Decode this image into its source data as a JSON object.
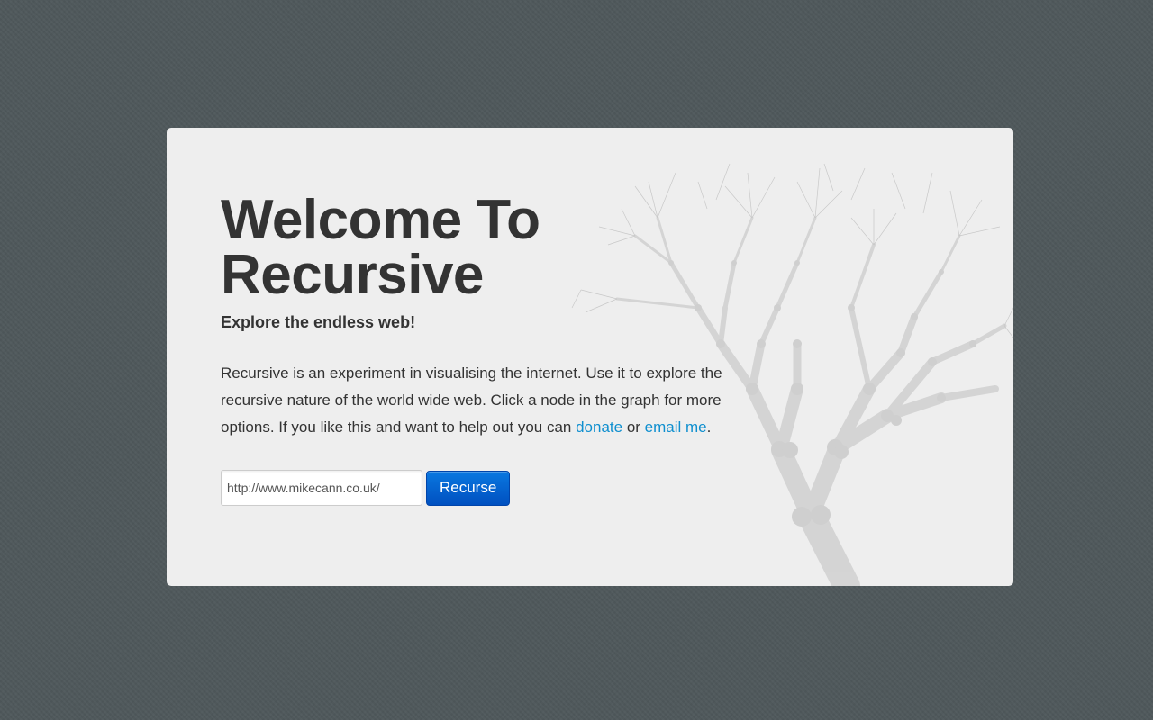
{
  "hero": {
    "title_line1": "Welcome To",
    "title_line2": "Recursive",
    "subtitle": "Explore the endless web!"
  },
  "description": {
    "text_before": "Recursive is an experiment in visualising the internet. Use it to explore the recursive nature of the world wide web. Click a node in the graph for more options. If you like this and want to help out you can ",
    "donate_link": "donate",
    "text_between": " or ",
    "email_link": "email me",
    "text_after": "."
  },
  "form": {
    "url_value": "http://www.mikecann.co.uk/",
    "button_label": "Recurse"
  },
  "colors": {
    "background": "#4f585b",
    "panel": "#eeeeee",
    "text": "#333333",
    "link": "#0f8fcf",
    "button": "#0060d0"
  },
  "icons": {
    "background_graphic": "tree-graph-illustration"
  }
}
